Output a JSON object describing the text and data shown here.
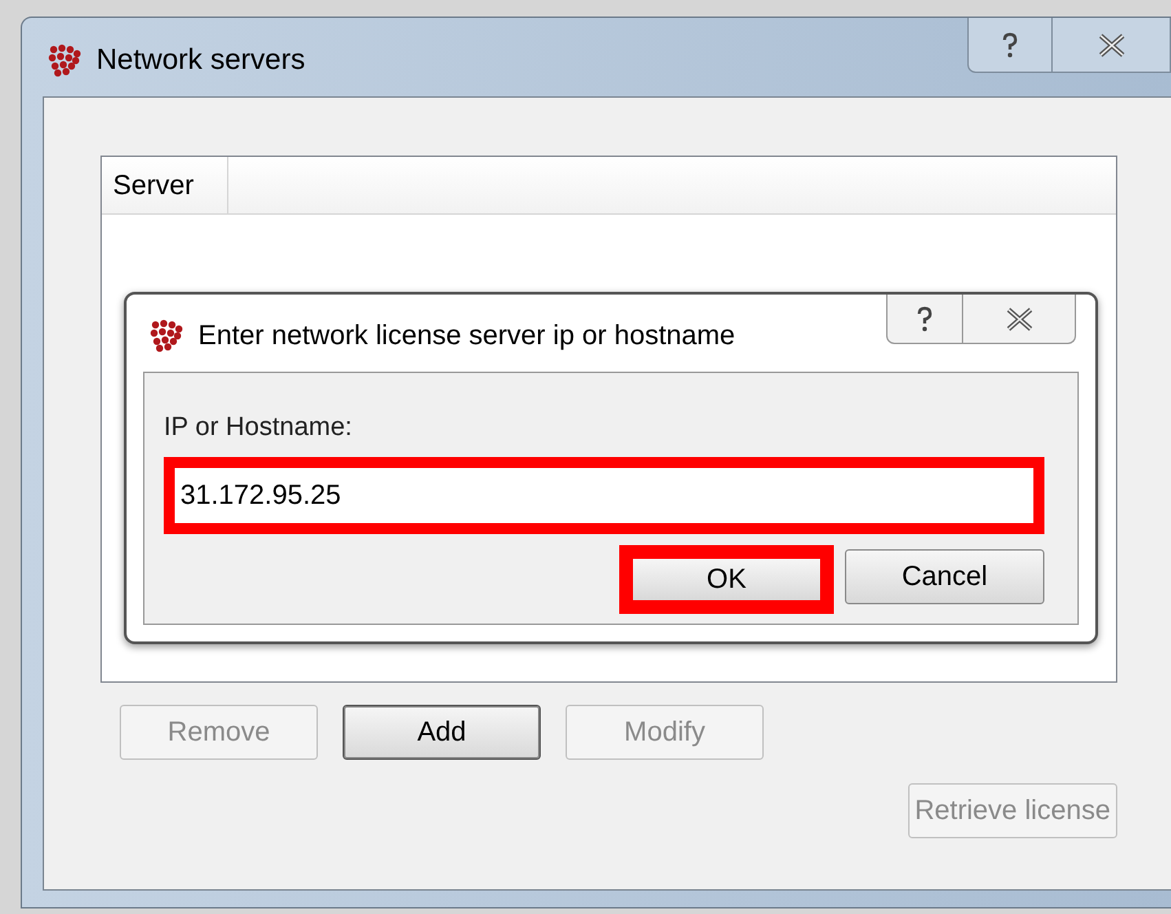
{
  "window": {
    "title": "Network servers"
  },
  "server_list": {
    "columns": [
      "Server"
    ]
  },
  "buttons": [
    {
      "label": "Remove",
      "disabled": true,
      "focused": false
    },
    {
      "label": "Add",
      "disabled": false,
      "focused": true
    },
    {
      "label": "Modify",
      "disabled": true,
      "focused": false
    }
  ],
  "retrieve_button": {
    "label": "Retrieve license",
    "disabled": true
  },
  "dialog": {
    "title": "Enter network license server ip or hostname",
    "field": {
      "label": "IP or Hostname:",
      "value": "31.172.95.25",
      "highlighted": true
    },
    "buttons": [
      {
        "label": "OK",
        "highlighted": true
      },
      {
        "label": "Cancel",
        "highlighted": false
      }
    ]
  }
}
